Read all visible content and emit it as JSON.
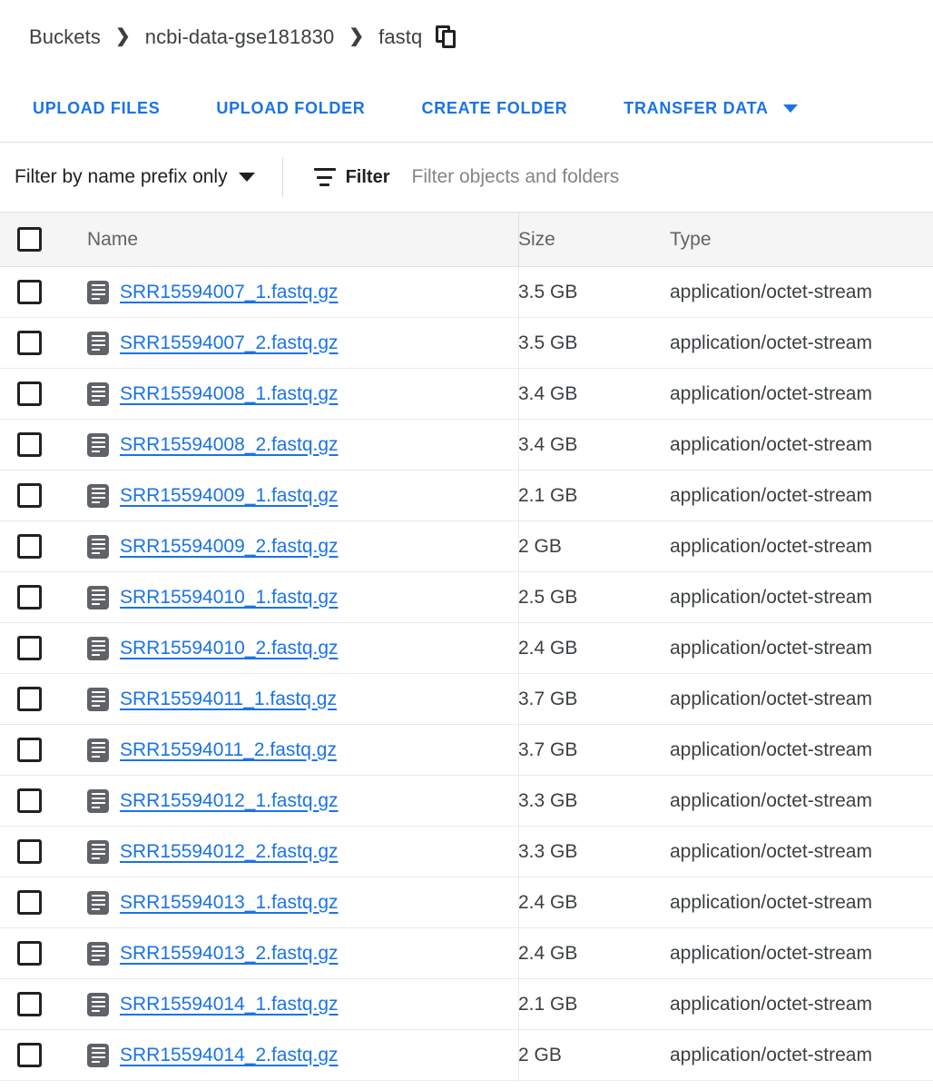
{
  "breadcrumb": {
    "items": [
      {
        "label": "Buckets"
      },
      {
        "label": "ncbi-data-gse181830"
      },
      {
        "label": "fastq"
      }
    ],
    "separator": "❯",
    "copy_icon": "copy-icon"
  },
  "toolbar": {
    "upload_files_label": "UPLOAD FILES",
    "upload_folder_label": "UPLOAD FOLDER",
    "create_folder_label": "CREATE FOLDER",
    "transfer_data_label": "TRANSFER DATA",
    "transfer_data_caret": "chevron-down-icon"
  },
  "filter_bar": {
    "prefix_select_label": "Filter by name prefix only",
    "prefix_select_caret": "chevron-down-icon",
    "filter_icon": "filter-list-icon",
    "filter_label": "Filter",
    "filter_placeholder": "Filter objects and folders",
    "filter_value": ""
  },
  "table": {
    "columns": {
      "name": "Name",
      "size": "Size",
      "type": "Type"
    },
    "rows": [
      {
        "name": "SRR15594007_1.fastq.gz",
        "size": "3.5 GB",
        "type": "application/octet-stream"
      },
      {
        "name": "SRR15594007_2.fastq.gz",
        "size": "3.5 GB",
        "type": "application/octet-stream"
      },
      {
        "name": "SRR15594008_1.fastq.gz",
        "size": "3.4 GB",
        "type": "application/octet-stream"
      },
      {
        "name": "SRR15594008_2.fastq.gz",
        "size": "3.4 GB",
        "type": "application/octet-stream"
      },
      {
        "name": "SRR15594009_1.fastq.gz",
        "size": "2.1 GB",
        "type": "application/octet-stream"
      },
      {
        "name": "SRR15594009_2.fastq.gz",
        "size": "2 GB",
        "type": "application/octet-stream"
      },
      {
        "name": "SRR15594010_1.fastq.gz",
        "size": "2.5 GB",
        "type": "application/octet-stream"
      },
      {
        "name": "SRR15594010_2.fastq.gz",
        "size": "2.4 GB",
        "type": "application/octet-stream"
      },
      {
        "name": "SRR15594011_1.fastq.gz",
        "size": "3.7 GB",
        "type": "application/octet-stream"
      },
      {
        "name": "SRR15594011_2.fastq.gz",
        "size": "3.7 GB",
        "type": "application/octet-stream"
      },
      {
        "name": "SRR15594012_1.fastq.gz",
        "size": "3.3 GB",
        "type": "application/octet-stream"
      },
      {
        "name": "SRR15594012_2.fastq.gz",
        "size": "3.3 GB",
        "type": "application/octet-stream"
      },
      {
        "name": "SRR15594013_1.fastq.gz",
        "size": "2.4 GB",
        "type": "application/octet-stream"
      },
      {
        "name": "SRR15594013_2.fastq.gz",
        "size": "2.4 GB",
        "type": "application/octet-stream"
      },
      {
        "name": "SRR15594014_1.fastq.gz",
        "size": "2.1 GB",
        "type": "application/octet-stream"
      },
      {
        "name": "SRR15594014_2.fastq.gz",
        "size": "2 GB",
        "type": "application/octet-stream"
      }
    ]
  },
  "colors": {
    "link_blue": "#1a73e8",
    "text_primary": "#202124",
    "text_secondary": "#5f6368",
    "header_bg": "#f5f5f5",
    "divider": "#e8eaed",
    "file_icon": "#5f6368"
  }
}
